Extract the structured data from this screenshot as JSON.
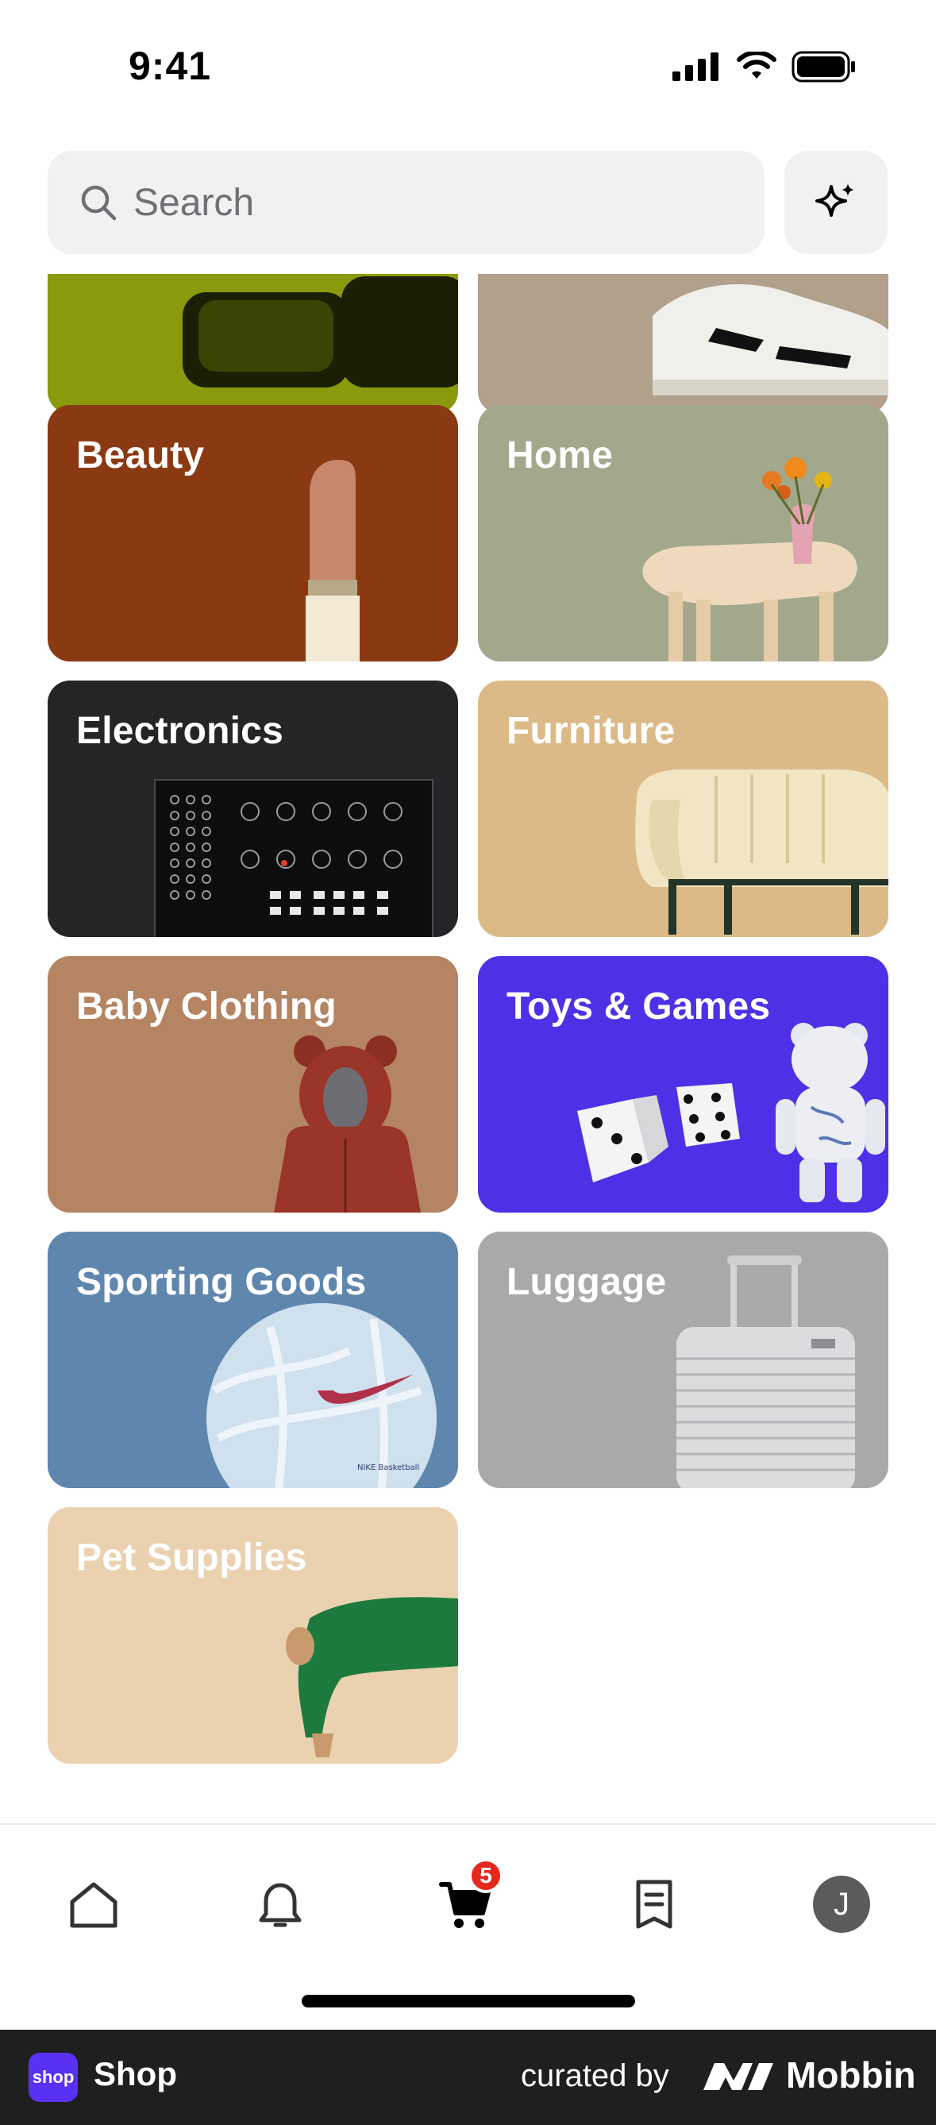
{
  "status_bar": {
    "time": "9:41"
  },
  "search": {
    "placeholder": "Search"
  },
  "categories": [
    {
      "label": "",
      "color": "#8a9a0c"
    },
    {
      "label": "",
      "color": "#b1a08c"
    },
    {
      "label": "Beauty",
      "color": "#8a3a13"
    },
    {
      "label": "Home",
      "color": "#a3a88d"
    },
    {
      "label": "Electronics",
      "color": "#252528"
    },
    {
      "label": "Furniture",
      "color": "#dcba88"
    },
    {
      "label": "Baby Clothing",
      "color": "#b58462"
    },
    {
      "label": "Toys & Games",
      "color": "#5030e6"
    },
    {
      "label": "Sporting Goods",
      "color": "#5f87ae"
    },
    {
      "label": "Luggage",
      "color": "#a9a9a9"
    },
    {
      "label": "Pet Supplies",
      "color": "#ead2b0"
    }
  ],
  "tab_bar": {
    "items": [
      {
        "name": "home",
        "icon": "home-icon"
      },
      {
        "name": "notifications",
        "icon": "bell-icon"
      },
      {
        "name": "cart",
        "icon": "cart-icon",
        "badge": "5"
      },
      {
        "name": "orders",
        "icon": "receipt-icon"
      },
      {
        "name": "profile",
        "icon": "avatar",
        "initial": "J"
      }
    ]
  },
  "footer": {
    "app_name": "Shop",
    "app_logo_text": "shop",
    "curated_by": "curated by",
    "brand": "Mobbin"
  }
}
